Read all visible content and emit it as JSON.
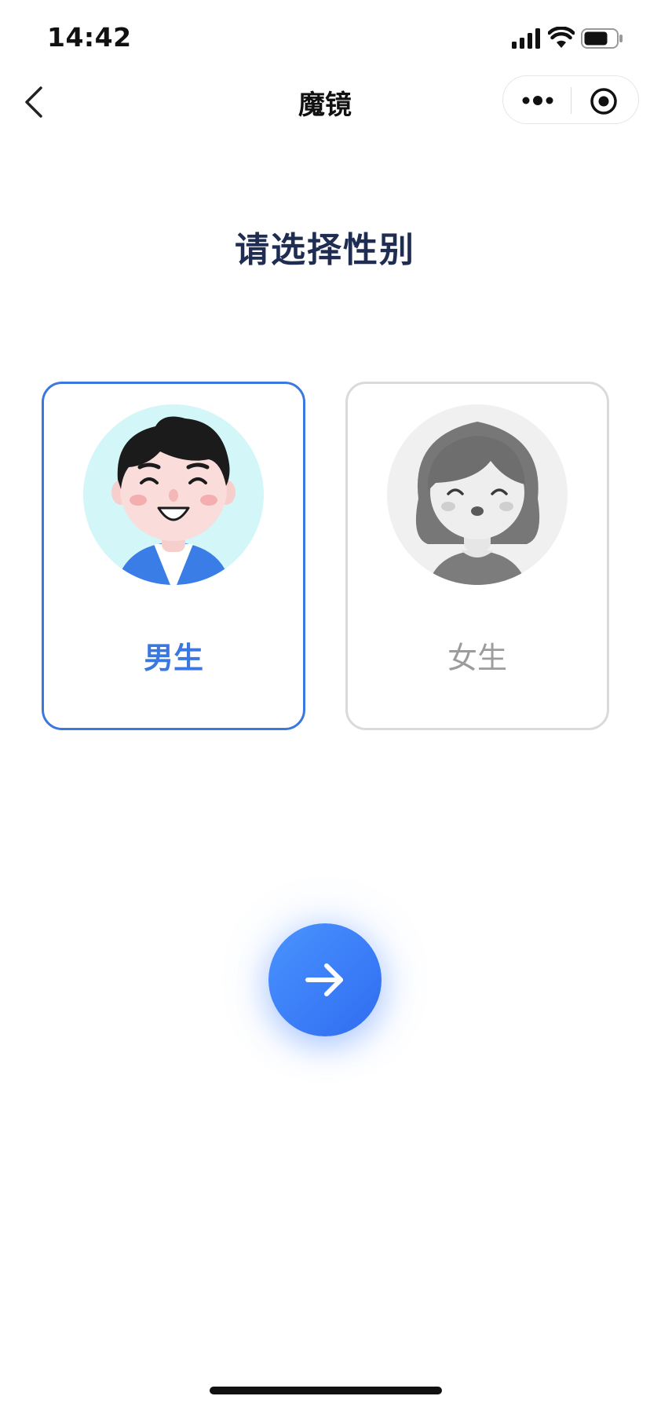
{
  "status_bar": {
    "time": "14:42",
    "icons": [
      "signal-icon",
      "wifi-icon",
      "battery-icon"
    ]
  },
  "nav": {
    "back_icon": "chevron-left-icon",
    "title": "魔镜",
    "capsule_icons": [
      "more-icon",
      "target-icon"
    ]
  },
  "page": {
    "title": "请选择性别"
  },
  "gender_options": [
    {
      "label": "男生",
      "selected": true,
      "icon": "male-avatar-icon"
    },
    {
      "label": "女生",
      "selected": false,
      "icon": "female-avatar-icon"
    }
  ],
  "next_button": {
    "icon": "arrow-right-icon"
  },
  "colors": {
    "accent": "#3a78e0",
    "title": "#1f2d53",
    "unselected_border": "#dadada",
    "unselected_text": "#9c9c9c",
    "button_gradient_start": "#4a93ff",
    "button_gradient_end": "#2f6cf0"
  }
}
